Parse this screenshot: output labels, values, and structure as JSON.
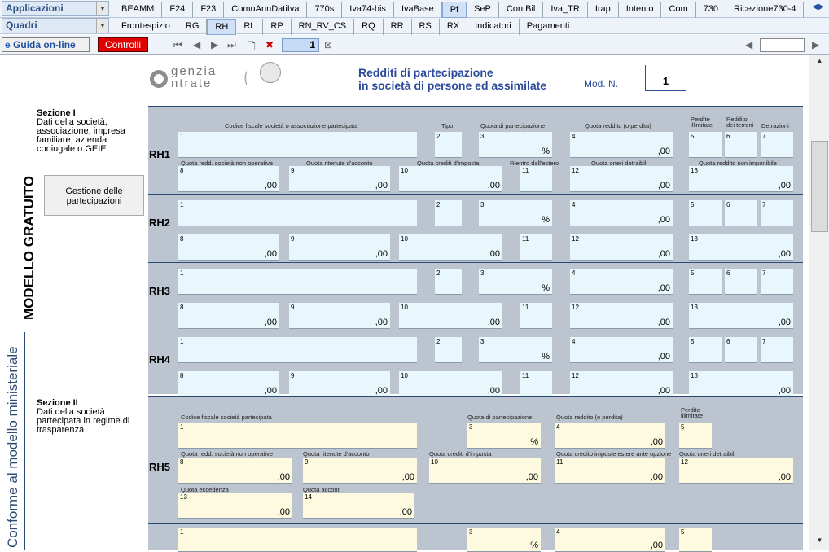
{
  "toolbar": {
    "apps_combo": "Applicazioni",
    "quadri_combo": "Quadri",
    "top_tabs": [
      "BEAMM",
      "F24",
      "F23",
      "ComuAnnDatiIva",
      "770s",
      "Iva74-bis",
      "IvaBase",
      "Pf",
      "SeP",
      "ContBil",
      "Iva_TR",
      "Irap",
      "Intento",
      "Com",
      "730",
      "Ricezione730-4"
    ],
    "active_top_tab": "Pf",
    "quadri_tabs": [
      "Frontespizio",
      "RG",
      "RH",
      "RL",
      "RP",
      "RN_RV_CS",
      "RQ",
      "RR",
      "RS",
      "RX",
      "Indicatori",
      "Pagamenti"
    ],
    "active_quadri_tab": "RH",
    "guida_label": "Guida on-line",
    "controlli_label": "Controlli",
    "page_number": "1"
  },
  "header": {
    "logo_top": "genzia",
    "logo_bottom": "ntrate",
    "title_line1": "Redditi di partecipazione",
    "title_line2": "in società di persone ed assimilate",
    "mod_label": "Mod. N.",
    "mod_value": "1"
  },
  "sidebar": {
    "modello": "MODELLO GRATUITO",
    "conforme": "Conforme al modello ministeriale"
  },
  "section1": {
    "title": "Sezione I",
    "desc": "Dati della società, associazione, impresa familiare, azienda coniugale o GEIE",
    "button": "Gestione delle partecipazioni",
    "headers": {
      "cf": "Codice fiscale società o associazione partecipata",
      "tipo": "Tipo",
      "quota_part": "Quota di partecipazione",
      "quota_reddito": "Quota reddito (o perdita)",
      "perdite": "Perdite illimitate",
      "reddito_terreni": "Reddito dei terreni",
      "detrazioni": "Detrazioni",
      "non_operative": "Quota redd. società non operative",
      "ritenute": "Quota ritenute d'acconto",
      "crediti": "Quota crediti d'imposta",
      "rientro": "Rientro dall'estero",
      "oneri": "Quota oneri detraibili",
      "non_imponibile": "Quota reddito non imponibile"
    },
    "rows": [
      "RH1",
      "RH2",
      "RH3",
      "RH4"
    ]
  },
  "section2": {
    "title": "Sezione II",
    "desc": "Dati della società partecipata in regime di trasparenza",
    "headers": {
      "cf": "Codice fiscale società partecipata",
      "quota_part": "Quota di partecipazione",
      "quota_reddito": "Quota reddito (o perdita)",
      "perdite": "Perdite illimitate",
      "non_operative": "Quota redd. società non operative",
      "ritenute": "Quota ritenute d'acconto",
      "crediti": "Quota crediti d'imposta",
      "crediti_esteri": "Quota credito imposte estere ante opzione",
      "oneri": "Quota oneri detraibili",
      "eccedenza": "Quota eccedenza",
      "acconti": "Quota acconti"
    },
    "rows": [
      "RH5"
    ]
  },
  "values": {
    "zero": ",00",
    "pct": "%"
  }
}
